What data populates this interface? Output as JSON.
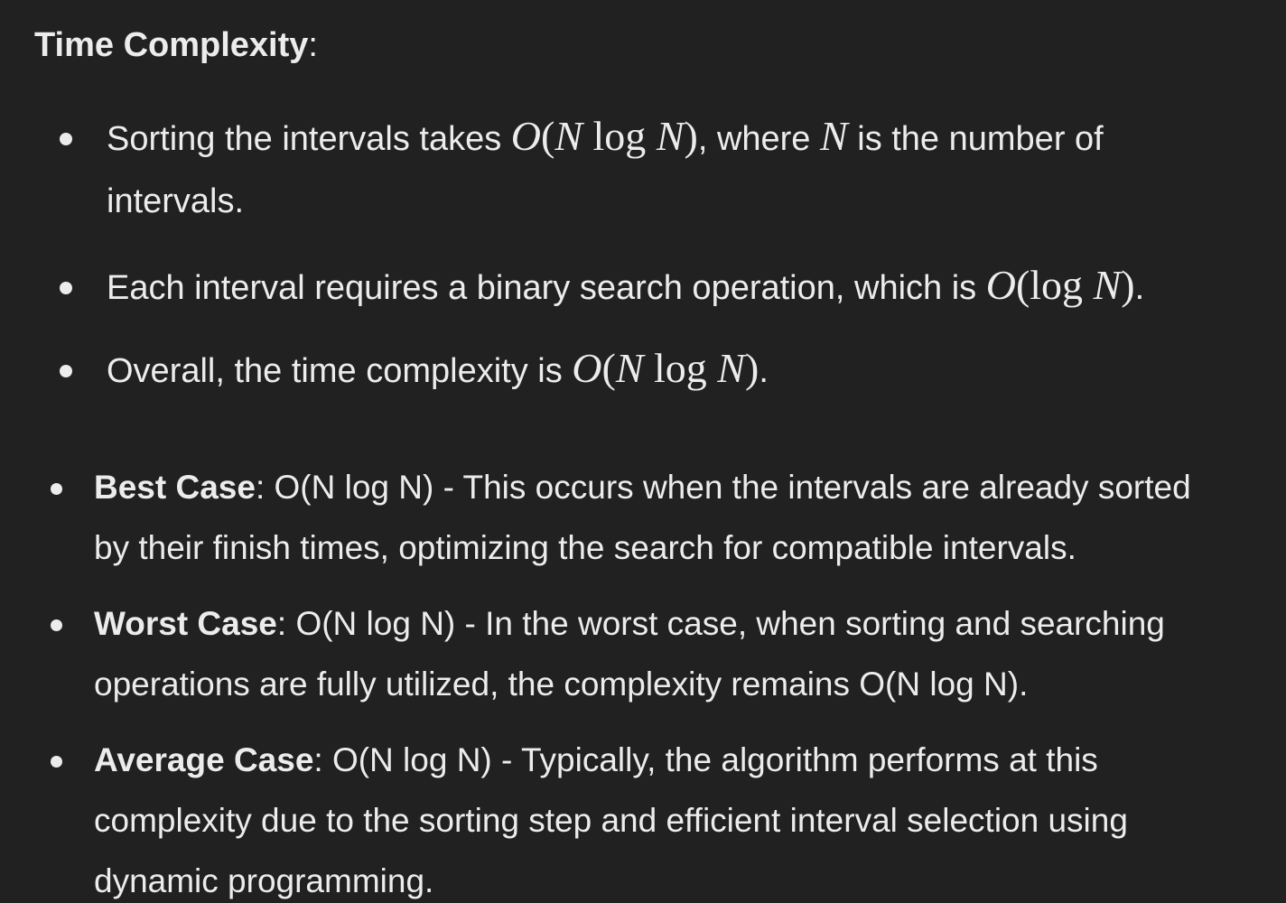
{
  "heading": {
    "title": "Time Complexity",
    "colon": ":"
  },
  "complexity_points": [
    {
      "pre": "Sorting the intervals takes ",
      "math1": {
        "O": "O",
        "open": "(",
        "N1": "N",
        "log": " log ",
        "N2": "N",
        "close": ")"
      },
      "mid": ", where ",
      "var": "N",
      "post": " is the number of",
      "line2": "intervals."
    },
    {
      "pre": "Each interval requires a binary search operation, which is ",
      "math": {
        "O": "O",
        "open": "(",
        "log": "log ",
        "N": "N",
        "close": ")"
      },
      "post": "."
    },
    {
      "pre": "Overall, the time complexity is ",
      "math": {
        "O": "O",
        "open": "(",
        "N1": "N",
        "log": " log ",
        "N2": "N",
        "close": ")"
      },
      "post": "."
    }
  ],
  "cases": [
    {
      "label": "Best Case",
      "line1": ": O(N log N) - This occurs when the intervals are already sorted",
      "line2": "by their finish times, optimizing the search for compatible intervals."
    },
    {
      "label": "Worst Case",
      "line1": ": O(N log N) - In the worst case, when sorting and searching",
      "line2": "operations are fully utilized, the complexity remains O(N log N)."
    },
    {
      "label": "Average Case",
      "line1": ": O(N log N) - Typically, the algorithm performs at this",
      "line2": "complexity due to the sorting step and efficient interval selection using",
      "line3": "dynamic programming."
    }
  ]
}
